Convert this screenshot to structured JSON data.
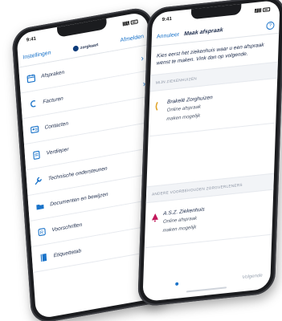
{
  "left_phone": {
    "status": {
      "time": "9:41"
    },
    "navbar": {
      "left_link": "Instellingen",
      "brand": "zorgkaart",
      "right_link": "Afmelden"
    },
    "menu": [
      {
        "label": "Afspraken",
        "icon": "calendar-icon"
      },
      {
        "label": "Facturen",
        "icon": "euro-icon"
      },
      {
        "label": "Contacten",
        "icon": "contact-icon"
      },
      {
        "label": "Verdieper",
        "icon": "document-icon"
      },
      {
        "label": "Technische ondersteunen",
        "icon": "wrench-icon"
      },
      {
        "label": "Documenten en bewijzen",
        "icon": "folder-icon"
      },
      {
        "label": "Voorschriften",
        "icon": "prescription-icon"
      },
      {
        "label": "Etiquettetab",
        "icon": "book-icon"
      }
    ]
  },
  "right_phone": {
    "status": {
      "time": "9:41"
    },
    "navbar": {
      "back_link": "Annuleer",
      "title": "Maak afspraak",
      "help": "?"
    },
    "intro": "Kies eerst het ziekenhuis waar u een afspraak wenst te maken. Vink dan op volgende.",
    "section1_head": "Mijn ziekenhuizen",
    "hospital1": {
      "name": "Brakelé Zorghuizen",
      "line1": "Online afspraak",
      "line2": "maken mogelijk"
    },
    "section2_head": "Andere voorbehouden zorgverleners",
    "hospital2": {
      "name": "A.S.Z. Ziekenhuis",
      "line1": "Online afspraak",
      "line2": "maken mogelijk"
    },
    "footer": "Volgende"
  },
  "colors": {
    "accent": "#1a73c9",
    "text_dark": "#1b2a4a",
    "frame": "#1b1c1f",
    "hospital2_logo": "#c2185b",
    "hospital1_logo": "#e0a42a"
  }
}
